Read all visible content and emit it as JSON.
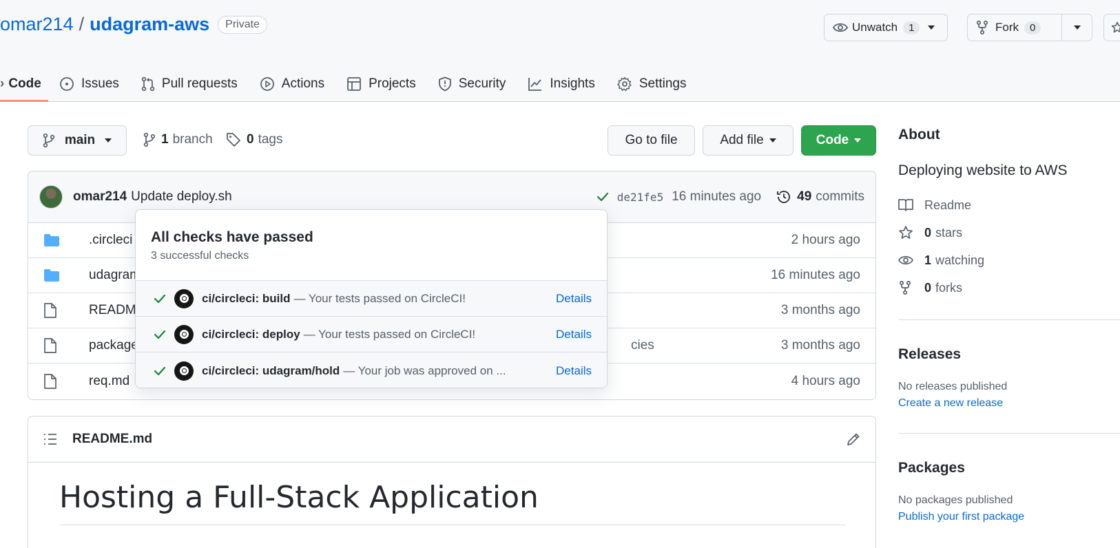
{
  "repo": {
    "owner": "omar214",
    "separator": "/",
    "name": "udagram-aws",
    "visibility": "Private"
  },
  "header_buttons": {
    "unwatch_label": "Unwatch",
    "unwatch_count": "1",
    "fork_label": "Fork",
    "fork_count": "0"
  },
  "tabs": [
    {
      "label": "Code",
      "icon": "code-icon",
      "active": true
    },
    {
      "label": "Issues",
      "icon": "issues-icon"
    },
    {
      "label": "Pull requests",
      "icon": "pull-request-icon"
    },
    {
      "label": "Actions",
      "icon": "play-icon"
    },
    {
      "label": "Projects",
      "icon": "table-icon"
    },
    {
      "label": "Security",
      "icon": "shield-icon"
    },
    {
      "label": "Insights",
      "icon": "graph-icon"
    },
    {
      "label": "Settings",
      "icon": "gear-icon"
    }
  ],
  "toolbar": {
    "branch": "main",
    "branches_count": "1",
    "branches_label": "branch",
    "tags_count": "0",
    "tags_label": "tags",
    "go_to_file": "Go to file",
    "add_file": "Add file",
    "code": "Code"
  },
  "commit": {
    "author": "omar214",
    "message": "Update deploy.sh",
    "sha": "de21fe5",
    "time": "16 minutes ago",
    "commits_count": "49",
    "commits_label": "commits"
  },
  "files": [
    {
      "type": "folder",
      "name": ".circleci",
      "message": "",
      "age": "2 hours ago"
    },
    {
      "type": "folder",
      "name": "udagram",
      "message": "",
      "age": "16 minutes ago"
    },
    {
      "type": "file",
      "name": "README.m",
      "message": "",
      "age": "3 months ago"
    },
    {
      "type": "file",
      "name": "package.js",
      "message": "cies",
      "age": "3 months ago"
    },
    {
      "type": "file",
      "name": "req.md",
      "message": "",
      "age": "4 hours ago"
    }
  ],
  "readme": {
    "filename": "README.md",
    "heading": "Hosting a Full-Stack Application"
  },
  "about": {
    "title": "About",
    "description": "Deploying website to AWS",
    "readme_label": "Readme",
    "stars_count": "0",
    "stars_label": "stars",
    "watching_count": "1",
    "watching_label": "watching",
    "forks_count": "0",
    "forks_label": "forks"
  },
  "releases": {
    "title": "Releases",
    "empty": "No releases published",
    "create_link": "Create a new release"
  },
  "packages": {
    "title": "Packages",
    "empty": "No packages published",
    "publish_link": "Publish your first package"
  },
  "checks_popover": {
    "title": "All checks have passed",
    "subtitle": "3 successful checks",
    "checks": [
      {
        "name": "ci/circleci: build",
        "desc": "— Your tests passed on CircleCI!",
        "link": "Details"
      },
      {
        "name": "ci/circleci: deploy",
        "desc": "— Your tests passed on CircleCI!",
        "link": "Details"
      },
      {
        "name": "ci/circleci: udagram/hold",
        "desc": "— Your job was approved on ...",
        "link": "Details"
      }
    ]
  },
  "colors": {
    "link": "#0969da",
    "green": "#2da44e",
    "active_tab_underline": "#fd8c73",
    "check": "#1a7f37"
  }
}
